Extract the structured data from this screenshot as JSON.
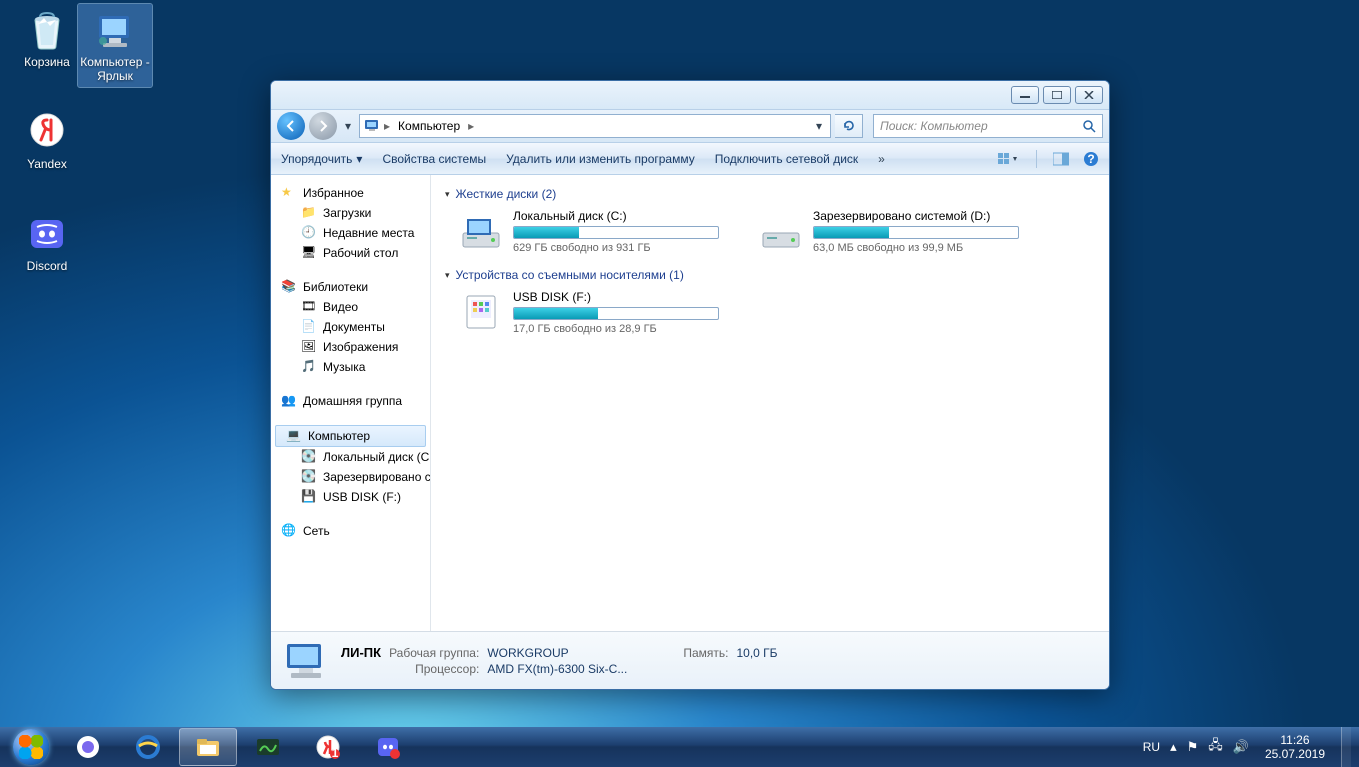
{
  "desktop_icons": [
    {
      "label": "Корзина",
      "name": "recycle-bin"
    },
    {
      "label": "Компьютер - Ярлык",
      "name": "computer-shortcut",
      "selected": true
    },
    {
      "label": "Yandex",
      "name": "yandex"
    },
    {
      "label": "Discord",
      "name": "discord"
    }
  ],
  "window": {
    "address": {
      "location": "Компьютер"
    },
    "search_placeholder": "Поиск: Компьютер",
    "toolbar": {
      "organize": "Упорядочить",
      "sysprops": "Свойства системы",
      "uninstall": "Удалить или изменить программу",
      "map_drive": "Подключить сетевой диск"
    },
    "sidebar": {
      "favorites": {
        "label": "Избранное",
        "items": [
          "Загрузки",
          "Недавние места",
          "Рабочий стол"
        ]
      },
      "libraries": {
        "label": "Библиотеки",
        "items": [
          "Видео",
          "Документы",
          "Изображения",
          "Музыка"
        ]
      },
      "homegroup": "Домашняя группа",
      "computer": {
        "label": "Компьютер",
        "items": [
          "Локальный диск (C:)",
          "Зарезервировано системой (D:)",
          "USB DISK (F:)"
        ]
      },
      "network": "Сеть"
    },
    "groups": {
      "hdd": {
        "title": "Жесткие диски (2)",
        "drives": [
          {
            "name": "Локальный диск (C:)",
            "free": "629 ГБ свободно из 931 ГБ",
            "fill": 32
          },
          {
            "name": "Зарезервировано системой (D:)",
            "free": "63,0 МБ свободно из 99,9 МБ",
            "fill": 37
          }
        ]
      },
      "removable": {
        "title": "Устройства со съемными носителями (1)",
        "drives": [
          {
            "name": "USB DISK (F:)",
            "free": "17,0 ГБ свободно из 28,9 ГБ",
            "fill": 41
          }
        ]
      }
    },
    "details": {
      "pc_name": "ЛИ-ПК",
      "workgroup_k": "Рабочая группа:",
      "workgroup_v": "WORKGROUP",
      "memory_k": "Память:",
      "memory_v": "10,0 ГБ",
      "cpu_k": "Процессор:",
      "cpu_v": "AMD FX(tm)-6300 Six-C..."
    }
  },
  "tray": {
    "lang": "RU",
    "time": "11:26",
    "date": "25.07.2019"
  }
}
